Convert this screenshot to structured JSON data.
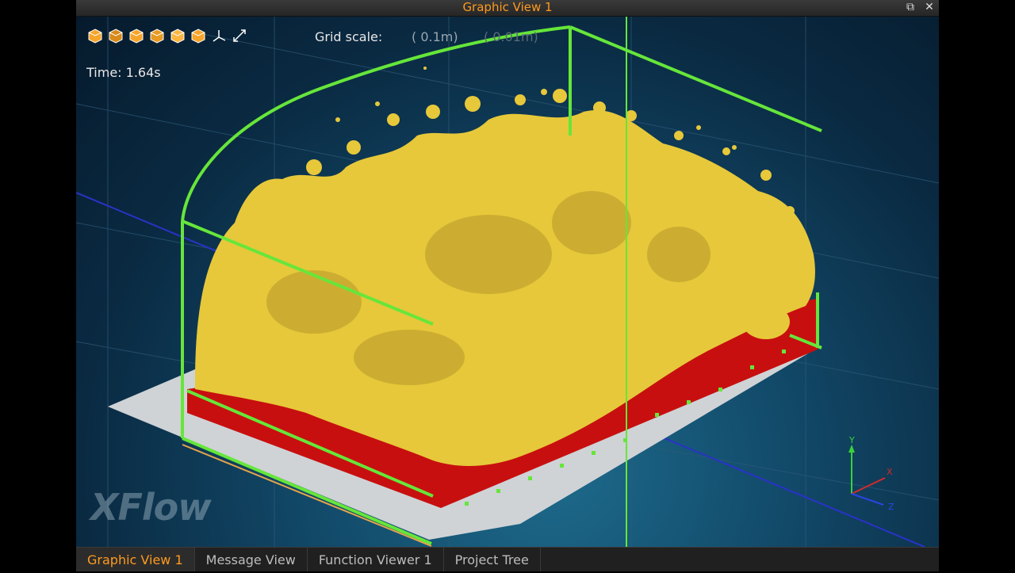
{
  "window": {
    "title": "Graphic View 1"
  },
  "hud": {
    "time_label": "Time: 1.64s",
    "grid_scale_label": "Grid scale:",
    "grid_scale_primary": "( 0.1m)",
    "grid_scale_secondary": "( 0.01m)"
  },
  "toolbar": {
    "tools": [
      "view-front-icon",
      "view-back-icon",
      "view-left-icon",
      "view-right-icon",
      "view-top-icon",
      "view-bottom-icon",
      "axes-icon",
      "fit-view-icon"
    ]
  },
  "axes": {
    "y": "Y",
    "x": "X",
    "z": "Z"
  },
  "watermark": "XFlow",
  "tabs": [
    {
      "label": "Graphic View 1",
      "active": true
    },
    {
      "label": "Message View",
      "active": false
    },
    {
      "label": "Function Viewer 1",
      "active": false
    },
    {
      "label": "Project Tree",
      "active": false
    }
  ],
  "colors": {
    "accent": "#ff9a1f",
    "fluid": "#e6c83a",
    "floor_fluid": "#c80f0f",
    "domain_box": "#66e63a"
  }
}
